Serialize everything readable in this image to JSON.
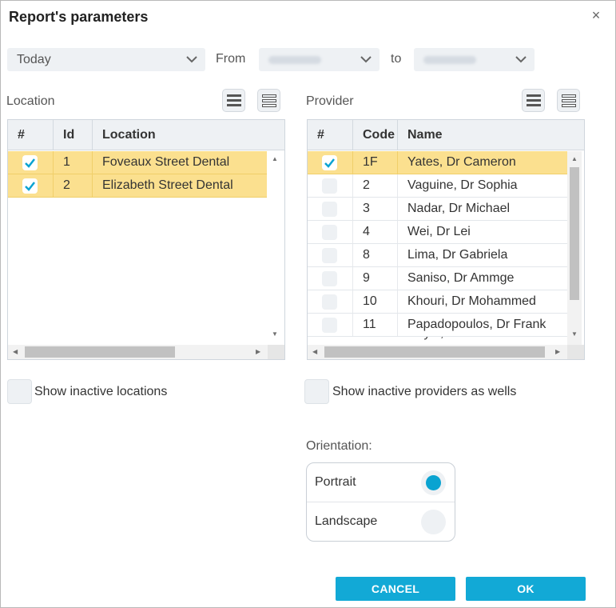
{
  "dialog": {
    "title": "Report's parameters",
    "close": "×"
  },
  "date_range": {
    "period": "Today",
    "from_label": "From",
    "to_label": "to"
  },
  "location": {
    "label": "Location",
    "columns": [
      "#",
      "Id",
      "Location"
    ],
    "rows": [
      {
        "checked": true,
        "id": "1",
        "name": "Foveaux Street Dental"
      },
      {
        "checked": true,
        "id": "2",
        "name": "Elizabeth Street Dental"
      }
    ],
    "show_inactive_label": "Show inactive locations"
  },
  "provider": {
    "label": "Provider",
    "columns": [
      "#",
      "Code",
      "Name"
    ],
    "rows": [
      {
        "checked": true,
        "code": "1F",
        "name": "Yates, Dr Cameron"
      },
      {
        "checked": false,
        "code": "2",
        "name": "Vaguine, Dr Sophia"
      },
      {
        "checked": false,
        "code": "3",
        "name": "Nadar, Dr Michael"
      },
      {
        "checked": false,
        "code": "4",
        "name": "Wei, Dr Lei"
      },
      {
        "checked": false,
        "code": "8",
        "name": "Lima, Dr Gabriela"
      },
      {
        "checked": false,
        "code": "9",
        "name": "Saniso, Dr Ammge"
      },
      {
        "checked": false,
        "code": "10",
        "name": "Khouri, Dr Mohammed"
      },
      {
        "checked": false,
        "code": "11",
        "name": "Papadopoulos, Dr Frank"
      }
    ],
    "show_inactive_label": "Show inactive providers as wells"
  },
  "orientation": {
    "label": "Orientation:",
    "options": [
      {
        "label": "Portrait",
        "selected": true
      },
      {
        "label": "Landscape",
        "selected": false
      }
    ]
  },
  "buttons": {
    "cancel": "CANCEL",
    "ok": "OK"
  },
  "colors": {
    "accent": "#12a9d6",
    "selected_row": "#fbe08f",
    "field_bg": "#eef1f4"
  }
}
